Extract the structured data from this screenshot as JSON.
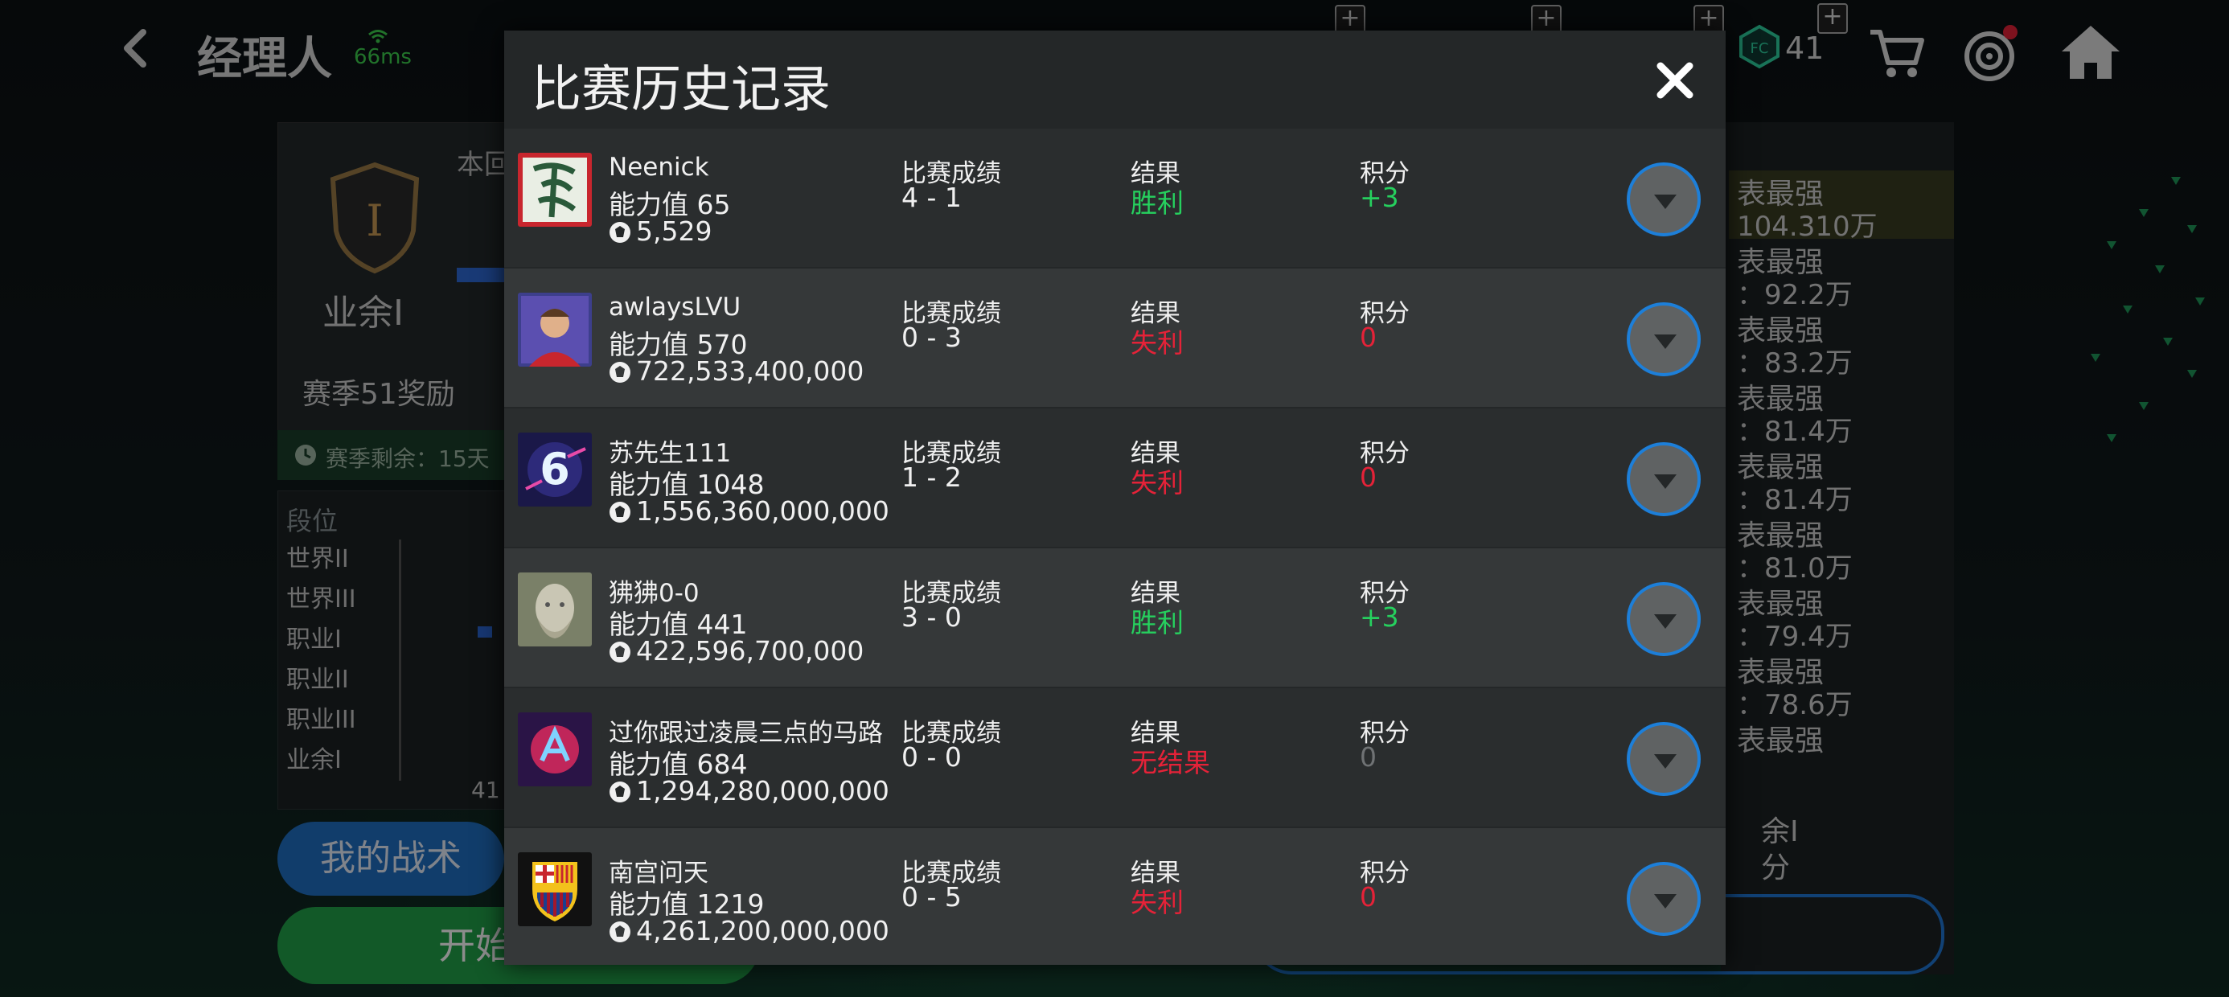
{
  "header": {
    "title": "经理人",
    "ping": "66ms",
    "currency_count": "41"
  },
  "left": {
    "round_label": "本回",
    "rank_name": "业余I",
    "rank_letter": "I",
    "season_reward": "赛季51奖励",
    "season_remaining": "赛季剩余：15天",
    "chart": {
      "heading": "段位",
      "levels": [
        "世界II",
        "世界III",
        "职业I",
        "职业II",
        "职业III",
        "业余I"
      ],
      "x_label": "41"
    },
    "tactics_button": "我的战术",
    "start_button": "开始"
  },
  "right": {
    "items": [
      {
        "l1": "表最强",
        "l2": "104.310万"
      },
      {
        "l1": "表最强",
        "l2": "：92.2万"
      },
      {
        "l1": "表最强",
        "l2": "：83.2万"
      },
      {
        "l1": "表最强",
        "l2": "：81.4万"
      },
      {
        "l1": "表最强",
        "l2": "：81.4万"
      },
      {
        "l1": "表最强",
        "l2": "：81.0万"
      },
      {
        "l1": "表最强",
        "l2": "：79.4万"
      },
      {
        "l1": "表最强",
        "l2": "：78.6万"
      },
      {
        "l1": "表最强",
        "l2": ""
      }
    ],
    "bottom1": "余I",
    "bottom2": "分"
  },
  "modal": {
    "title": "比赛历史记录",
    "labels": {
      "score": "比赛成绩",
      "result": "结果",
      "points": "积分"
    },
    "matches": [
      {
        "name": "Neenick",
        "power": "能力值 65",
        "value": "5,529",
        "score": "4 - 1",
        "result": "胜利",
        "result_type": "win",
        "points": "+3",
        "avatar": "dragon-calligraphy"
      },
      {
        "name": "awlaysLVU",
        "power": "能力值 570",
        "value": "722,533,400,000",
        "score": "0 - 3",
        "result": "失利",
        "result_type": "loss",
        "points": "0",
        "avatar": "player-portrait"
      },
      {
        "name": "苏先生111",
        "power": "能力值 1048",
        "value": "1,556,360,000,000",
        "score": "1 - 2",
        "result": "失利",
        "result_type": "loss",
        "points": "0",
        "avatar": "neon-six"
      },
      {
        "name": "狒狒0-0",
        "power": "能力值 441",
        "value": "422,596,700,000",
        "score": "3 - 0",
        "result": "胜利",
        "result_type": "win",
        "points": "+3",
        "avatar": "statue-head"
      },
      {
        "name": "过你跟过凌晨三点的马路",
        "power": "能力值 684",
        "value": "1,294,280,000,000",
        "score": "0 - 0",
        "result": "无结果",
        "result_type": "loss",
        "points": "0",
        "points_type": "grey",
        "avatar": "neon-emblem"
      },
      {
        "name": "南宫问天",
        "power": "能力值 1219",
        "value": "4,261,200,000,000",
        "score": "0 - 5",
        "result": "失利",
        "result_type": "loss",
        "points": "0",
        "avatar": "fcb-crest"
      }
    ]
  },
  "colors": {
    "win": "#26d05e",
    "loss": "#e52238",
    "accent_blue": "#1d7fd9",
    "modal_bg": "#242728"
  }
}
